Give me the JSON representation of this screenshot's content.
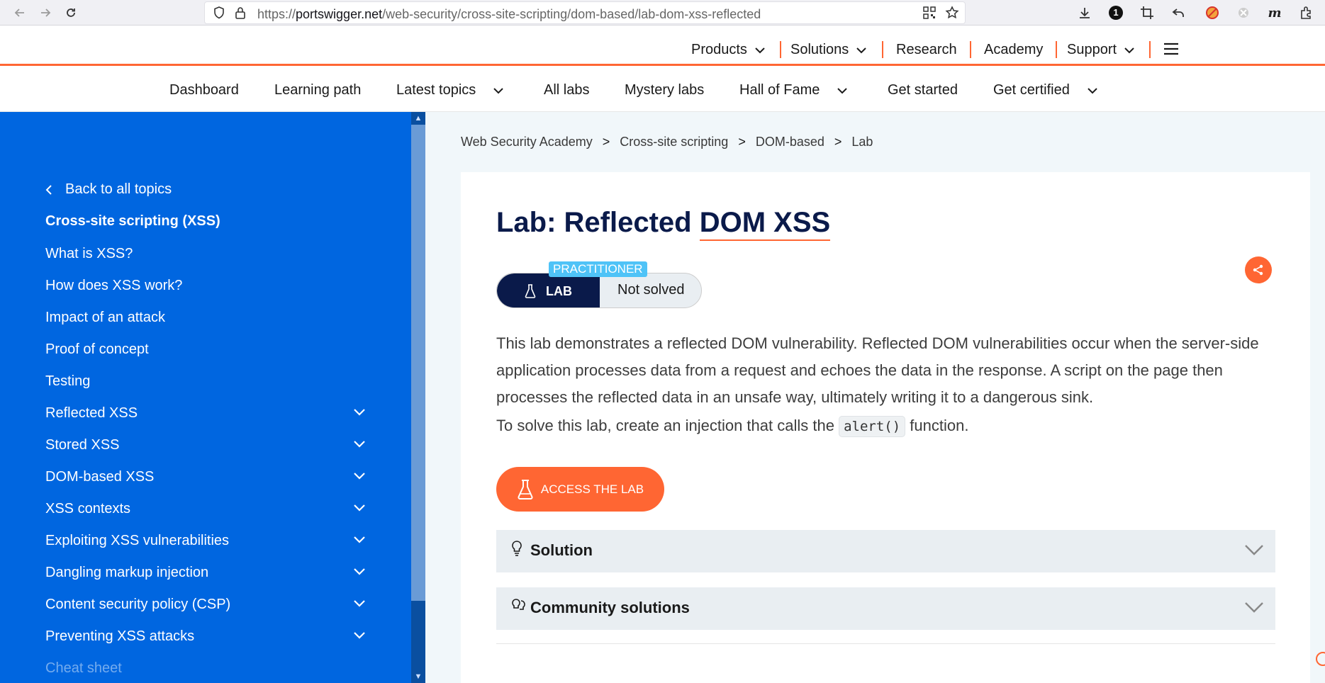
{
  "browser": {
    "url_prefix": "https://",
    "url_domain": "portswigger.net",
    "url_path": "/web-security/cross-site-scripting/dom-based/lab-dom-xss-reflected",
    "badge_one": "1"
  },
  "header": {
    "items": [
      "Products",
      "Solutions",
      "Research",
      "Academy",
      "Support"
    ]
  },
  "academy_nav": {
    "items": [
      "Dashboard",
      "Learning path",
      "Latest topics",
      "All labs",
      "Mystery labs",
      "Hall of Fame",
      "Get started",
      "Get certified"
    ]
  },
  "sidebar": {
    "back": "Back to all topics",
    "heading": "Cross-site scripting (XSS)",
    "links": [
      "What is XSS?",
      "How does XSS work?",
      "Impact of an attack",
      "Proof of concept",
      "Testing",
      "Reflected XSS",
      "Stored XSS",
      "DOM-based XSS",
      "XSS contexts",
      "Exploiting XSS vulnerabilities",
      "Dangling markup injection",
      "Content security policy (CSP)",
      "Preventing XSS attacks",
      "Cheat sheet"
    ]
  },
  "breadcrumb": {
    "items": [
      "Web Security Academy",
      "Cross-site scripting",
      "DOM-based",
      "Lab"
    ],
    "separator": ">"
  },
  "lab": {
    "title_prefix": "Lab: Reflected ",
    "title_link": "DOM XSS",
    "level": "PRACTITIONER",
    "badge_label": "LAB",
    "status": "Not solved",
    "description": "This lab demonstrates a reflected DOM vulnerability. Reflected DOM vulnerabilities occur when the server-side application processes data from a request and echoes the data in the response. A script on the page then processes the reflected data in an unsafe way, ultimately writing it to a dangerous sink.",
    "task_before": "To solve this lab, create an injection that calls the",
    "task_code": "alert()",
    "task_after": "function.",
    "access_button": "ACCESS THE LAB",
    "solution_label": "Solution",
    "community_label": "Community solutions"
  },
  "colors": {
    "accent": "#ff6633",
    "sidebar_bg": "#0066e0",
    "navy": "#0a1a4a",
    "practitioner": "#4fc3f7"
  }
}
